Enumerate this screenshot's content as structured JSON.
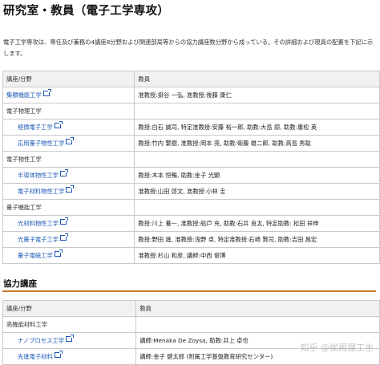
{
  "page_title": "研究室・教員（電子工学専攻）",
  "intro_text": "電子工学専攻は、専任及び兼務の4講座8分野および関連部局等からの協力講座数分野から成っている。その詳細および現員の配置を下記に示します。",
  "table1": {
    "headers": [
      "講座/分野",
      "教員"
    ],
    "rows": [
      {
        "kind": "link",
        "indent": false,
        "name": "集積機能工学",
        "staff": "准教授:掛谷 一弘, 准教授:後藤 康仁"
      },
      {
        "kind": "group",
        "name": "電子物理工学",
        "staff": ""
      },
      {
        "kind": "link",
        "indent": true,
        "name": "極微電子工学",
        "staff": "教授:白石 誠司, 特定准教授:安藤 裕一郎, 助教:大島 諒, 助教:重松 英"
      },
      {
        "kind": "link",
        "indent": true,
        "name": "応用量子物性工学",
        "staff": "教授:竹内 繁樹, 准教授:岡本 亮, 助教:衛藤 雄二郎, 助教:高島 秀聡"
      },
      {
        "kind": "group",
        "name": "電子物性工学",
        "staff": ""
      },
      {
        "kind": "link",
        "indent": true,
        "name": "半導体物性工学",
        "staff": "教授:木本 恒暢, 助教:金子 光顕"
      },
      {
        "kind": "link",
        "indent": true,
        "name": "電子材料物性工学",
        "staff": "准教授:山田 啓文, 准教授:小林 圭"
      },
      {
        "kind": "group",
        "name": "量子機能工学",
        "staff": ""
      },
      {
        "kind": "link",
        "indent": true,
        "name": "光材料物性工学",
        "staff": "教授:川上 養一, 准教授:船戸 充, 助教:石井 良太, 特定助教: 松田 祥伸"
      },
      {
        "kind": "link",
        "indent": true,
        "name": "光量子電子工学",
        "staff": "教授:野田 進, 准教授:浅野 卓, 特定准教授:石崎 賢司, 助教:吉田 昌宏"
      },
      {
        "kind": "link",
        "indent": true,
        "name": "量子電磁工学",
        "staff": "准教授:杉山 和彦, 講師:中西 俊博"
      }
    ]
  },
  "section2_title": "協力講座",
  "table2": {
    "headers": [
      "講座/分野",
      "教員"
    ],
    "rows": [
      {
        "kind": "group",
        "name": "高機能材料工学",
        "staff": ""
      },
      {
        "kind": "link",
        "indent": true,
        "name": "ナノプロセス工学",
        "staff": "講師:Menaka De Zoysa, 助教:井上 卓也"
      },
      {
        "kind": "link",
        "indent": true,
        "name": "先進電子材料",
        "staff": "講師:金子 健太郎 (附属工学基盤教育研究センター)"
      }
    ]
  },
  "watermark": "知乎 @挨踢理工生"
}
